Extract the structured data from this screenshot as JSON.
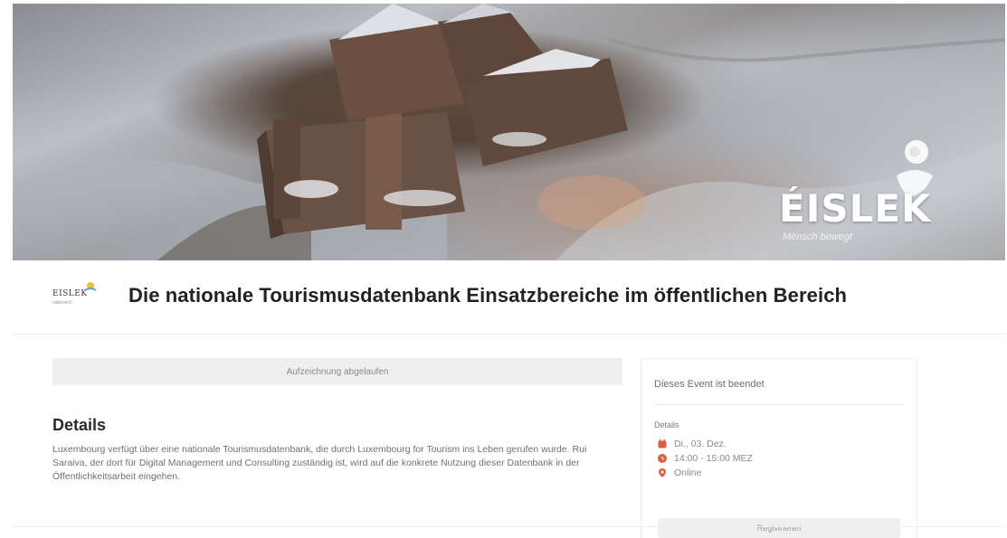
{
  "hero": {
    "brand": "ÉISLEK",
    "tagline": "Mënsch bewegt"
  },
  "organizer": {
    "name": "EISLEK",
    "sub": "natierlech"
  },
  "event": {
    "title": "Die nationale Tourismusdatenbank Einsatzbereiche im öffentlichen Bereich"
  },
  "main": {
    "recording_notice": "Aufzeichnung abgelaufen",
    "details_heading": "Details",
    "details_text": "Luxembourg verfügt über eine nationale Tourismusdatenbank, die durch Luxembourg for Tourism ins Leben gerufen wurde. Rui Saraiva, der dort für Digital Management und Consulting zuständig ist, wird auf die konkrete Nutzung dieser Datenbank in der Öffentlichkeitsarbeit eingehen."
  },
  "sidebar": {
    "ended_text": "Dieses Event ist beendet",
    "details_label": "Details",
    "date": "Di., 03. Dez.",
    "time": "14:00 - 15:00 MEZ",
    "location": "Online",
    "register_label": "Registrieren",
    "accent_color": "#d9613f"
  }
}
